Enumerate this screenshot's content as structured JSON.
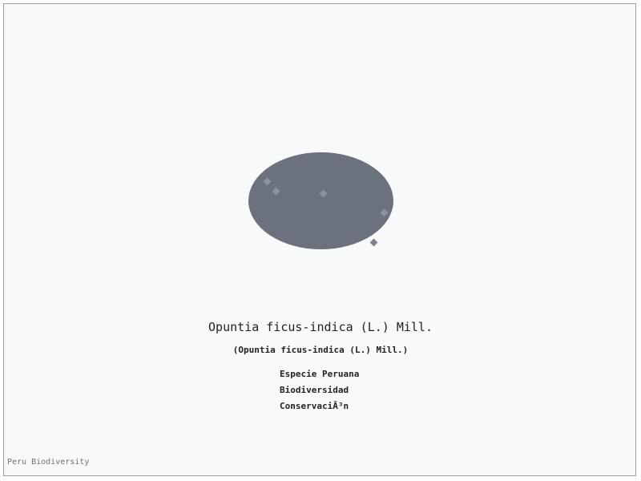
{
  "specimen": {
    "title": "Opuntia ficus-indica (L.) Mill.",
    "subtitle": "(Opuntia ficus-indica (L.) Mill.)",
    "image_icon": "cactus-pad-placeholder-icon"
  },
  "tags": [
    "Especie Peruana",
    "Biodiversidad",
    "ConservaciÃ³n"
  ],
  "footer": {
    "credit": "Peru Biodiversity"
  },
  "colors": {
    "blob": "#6b717d",
    "frame_border": "#9aa1ad",
    "background": "#f8f9fb",
    "text": "#222222"
  }
}
